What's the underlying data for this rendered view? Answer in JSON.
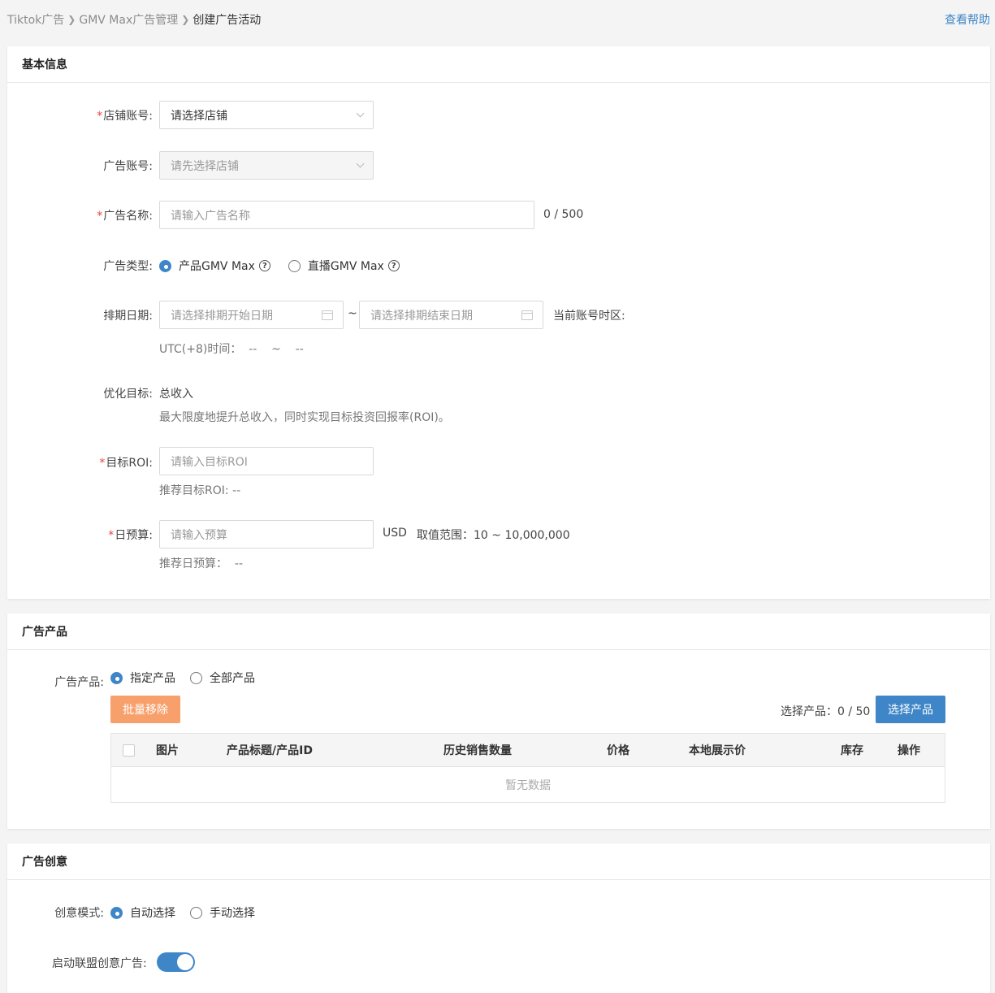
{
  "breadcrumb": {
    "items": [
      "Tiktok广告",
      "GMV Max广告管理",
      "创建广告活动"
    ],
    "separator": ">"
  },
  "help_link": "查看帮助",
  "basic_info": {
    "title": "基本信息",
    "store_account": {
      "label": "店铺账号",
      "placeholder": "请选择店铺",
      "required": true
    },
    "ad_account": {
      "label": "广告账号",
      "placeholder": "请先选择店铺",
      "disabled": true
    },
    "ad_name": {
      "label": "广告名称",
      "placeholder": "请输入广告名称",
      "counter": "0 / 500",
      "required": true
    },
    "ad_type": {
      "label": "广告类型",
      "options": [
        {
          "label": "产品GMV Max",
          "checked": true
        },
        {
          "label": "直播GMV Max",
          "checked": false
        }
      ]
    },
    "schedule": {
      "label": "排期日期",
      "start_placeholder": "请选择排期开始日期",
      "end_placeholder": "请选择排期结束日期",
      "range_sep": "~",
      "timezone_label": "当前账号时区:",
      "utc_text": "UTC(+8)时间：  --    ~    --"
    },
    "optimize_goal": {
      "label": "优化目标",
      "value": "总收入",
      "description": "最大限度地提升总收入，同时实现目标投资回报率(ROI)。"
    },
    "target_roi": {
      "label": "目标ROI",
      "placeholder": "请输入目标ROI",
      "hint": "推荐目标ROI: --",
      "required": true
    },
    "daily_budget": {
      "label": "日预算",
      "placeholder": "请输入预算",
      "currency": "USD",
      "range_text": "取值范围：10 ~ 10,000,000",
      "hint": "推荐日预算：  --",
      "required": true
    }
  },
  "ad_products": {
    "title": "广告产品",
    "label": "广告产品",
    "options": [
      {
        "label": "指定产品",
        "checked": true
      },
      {
        "label": "全部产品",
        "checked": false
      }
    ],
    "batch_remove": "批量移除",
    "selected_count": "选择产品：0 / 50",
    "select_button": "选择产品",
    "table": {
      "headers": [
        "图片",
        "产品标题/产品ID",
        "历史销售数量",
        "价格",
        "本地展示价",
        "库存",
        "操作"
      ],
      "empty_text": "暂无数据"
    }
  },
  "ad_creative": {
    "title": "广告创意",
    "mode": {
      "label": "创意模式",
      "options": [
        {
          "label": "自动选择",
          "checked": true
        },
        {
          "label": "手动选择",
          "checked": false
        }
      ]
    },
    "affiliate": {
      "label": "启动联盟创意广告",
      "enabled": true
    }
  },
  "colors": {
    "primary": "#3f86c8",
    "orange": "#f7a06b",
    "required": "#e84545"
  }
}
